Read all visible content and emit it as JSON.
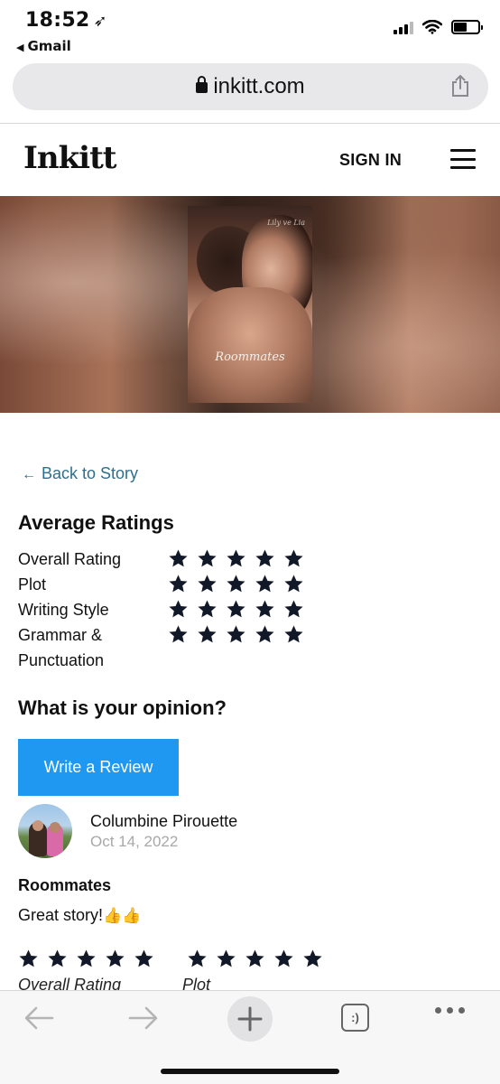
{
  "status_bar": {
    "time": "18:52",
    "location_icon": "location-arrow-icon",
    "back_app": "Gmail"
  },
  "browser": {
    "url": "inkitt.com"
  },
  "header": {
    "logo": "Inkitt",
    "sign_in": "SIGN IN"
  },
  "cover": {
    "title": "Roommates",
    "author": "Lily ve Lia"
  },
  "content": {
    "back_link": "Back to Story",
    "average_heading": "Average Ratings",
    "ratings": [
      {
        "label": "Overall Rating",
        "stars": 5
      },
      {
        "label": "Plot",
        "stars": 5
      },
      {
        "label": "Writing Style",
        "stars": 5
      },
      {
        "label": "Grammar & Punctuation",
        "stars": 5
      }
    ],
    "opinion_heading": "What is your opinion?",
    "write_review": "Write a Review"
  },
  "review": {
    "reviewer": "Columbine Pirouette",
    "date": "Oct 14, 2022",
    "title": "Roommates",
    "body": "Great story!",
    "ratings": [
      {
        "label": "Overall Rating",
        "stars": 5
      },
      {
        "label": "Plot",
        "stars": 5
      }
    ]
  },
  "colors": {
    "accent_button": "#1e98f0",
    "link": "#2b6f8e",
    "star": "#111827"
  }
}
